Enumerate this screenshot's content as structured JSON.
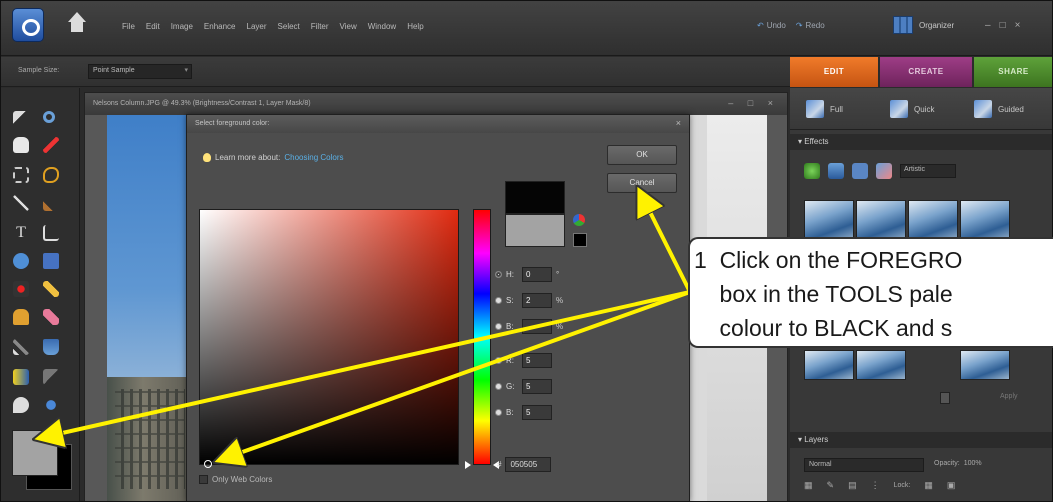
{
  "menubar": {
    "items": [
      "File",
      "Edit",
      "Image",
      "Enhance",
      "Layer",
      "Select",
      "Filter",
      "View",
      "Window",
      "Help"
    ],
    "undo_label": "Undo",
    "redo_label": "Redo",
    "organizer_label": "Organizer",
    "window_controls": [
      "–",
      "□",
      "×"
    ]
  },
  "options": {
    "sample_size_label": "Sample Size:",
    "sample_size_value": "Point Sample"
  },
  "modes": {
    "edit": "EDIT",
    "create": "CREATE",
    "share": "SHARE"
  },
  "document": {
    "title": "Nelsons Column.JPG @ 49.3% (Brightness/Contrast 1, Layer Mask/8)",
    "controls": "– □ ×"
  },
  "picker": {
    "title": "Select foreground color:",
    "learn_prefix": "Learn more about:",
    "learn_link": "Choosing Colors",
    "ok_label": "OK",
    "cancel_label": "Cancel",
    "fields": [
      {
        "label": "H:",
        "value": "0",
        "unit": "°",
        "selected": true
      },
      {
        "label": "S:",
        "value": "2",
        "unit": "%",
        "selected": false
      },
      {
        "label": "B:",
        "value": "",
        "unit": "%",
        "selected": false
      },
      {
        "label": "R:",
        "value": "5",
        "unit": "",
        "selected": false
      },
      {
        "label": "G:",
        "value": "5",
        "unit": "",
        "selected": false
      },
      {
        "label": "B:",
        "value": "5",
        "unit": "",
        "selected": false
      }
    ],
    "hex_label": "#",
    "hex_value": "050505",
    "web_colors_label": "Only Web Colors",
    "new_color": "#050505",
    "current_color": "#a3a3a3"
  },
  "panel": {
    "tabs": [
      "Full",
      "Quick",
      "Guided"
    ],
    "effects_header": "Effects",
    "effects_select": "Artistic",
    "apply_label": "Apply",
    "layers_header": "Layers",
    "blend_mode": "Normal",
    "opacity_label": "Opacity:",
    "opacity_value": "100%",
    "lock_label": "Lock:"
  },
  "toolbox": {
    "foreground_color": "#a3a3a3",
    "background_color": "#000000"
  },
  "callout": {
    "text": "1  Click on the FOREGRO\n    box in the TOOLS pale\n    colour to BLACK and s"
  },
  "colors": {
    "edit_tab": "#e0681f",
    "create_tab": "#8a2f74",
    "share_tab": "#4f8c2e",
    "arrow": "#fff200"
  }
}
